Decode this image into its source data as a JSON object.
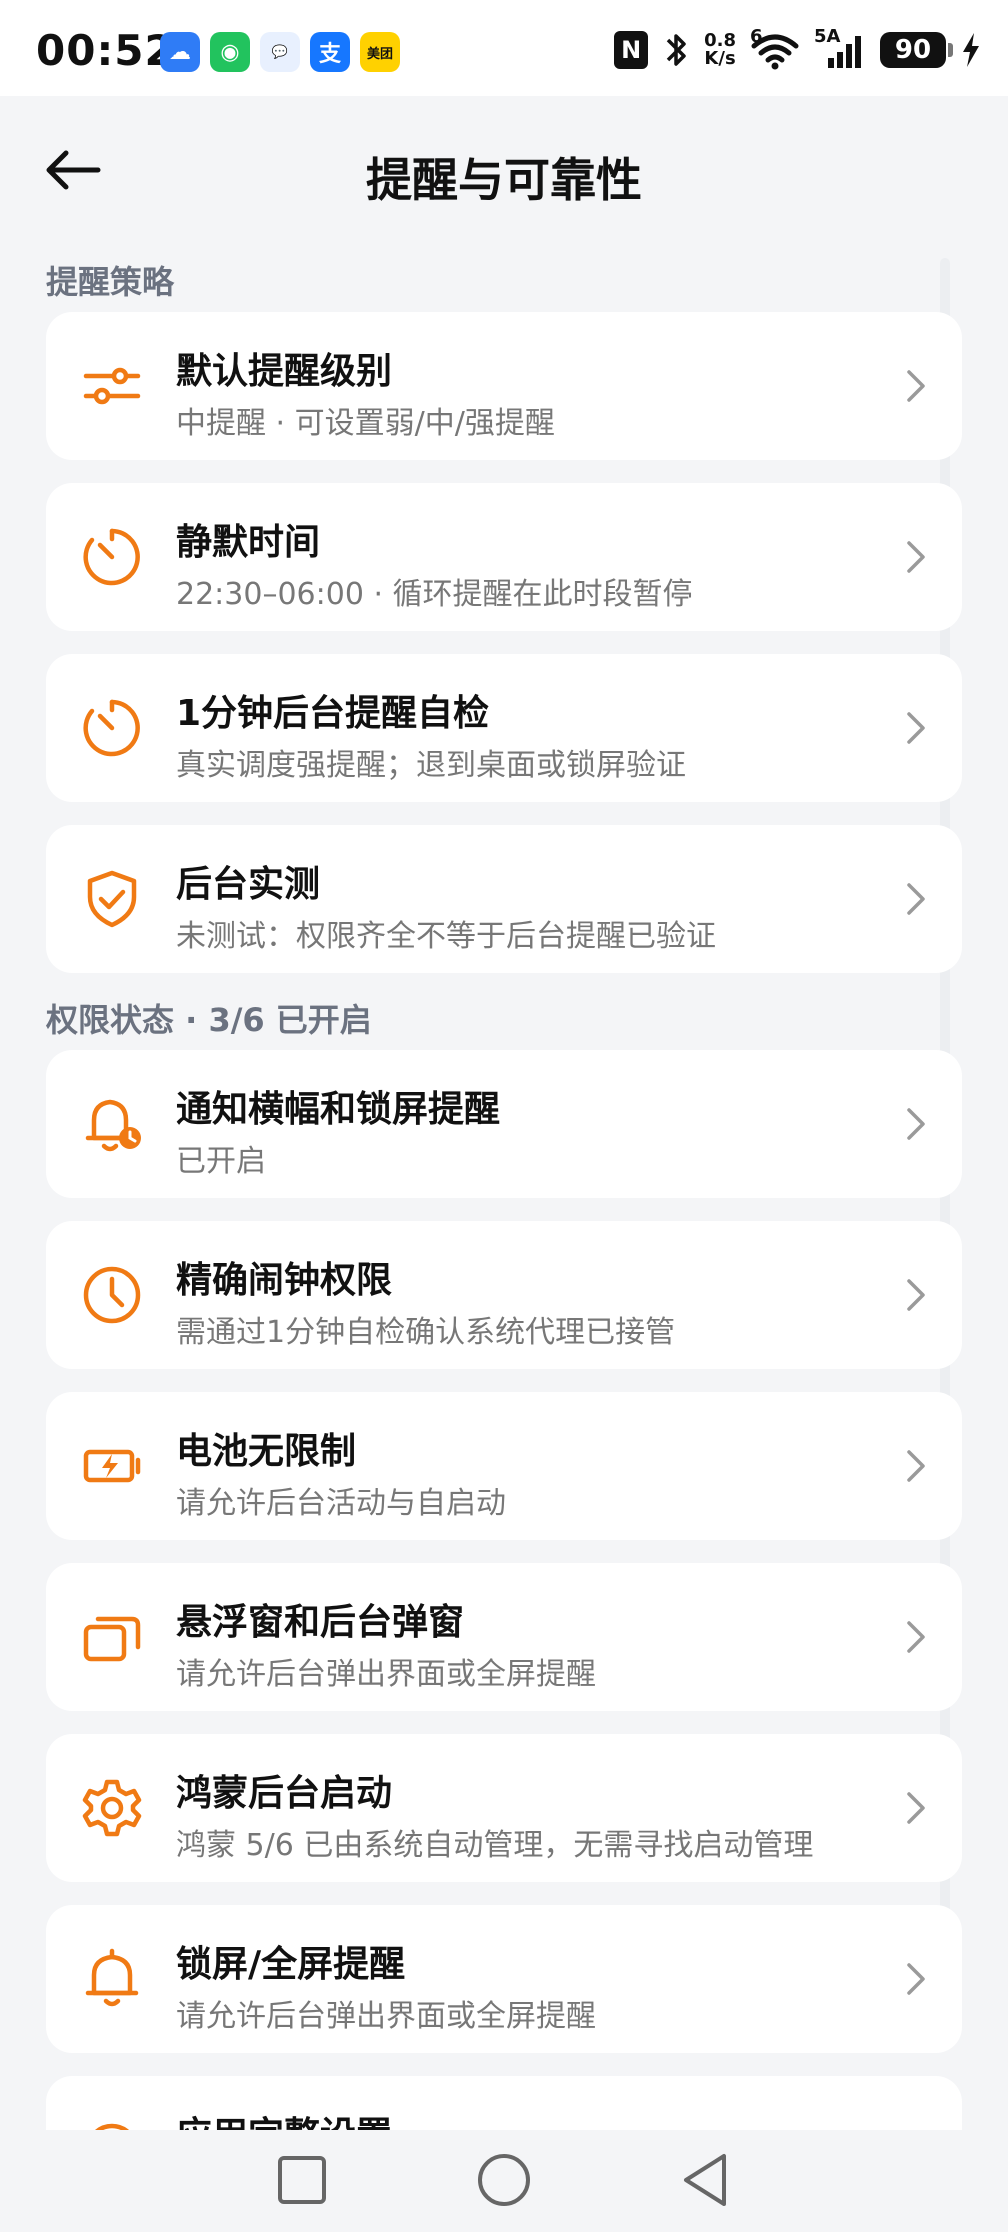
{
  "status": {
    "time": "00:52",
    "apps": [
      {
        "name": "weather-app-icon",
        "glyph": "☁",
        "color": "#2f7cf6"
      },
      {
        "name": "wechat-shield-icon",
        "glyph": "◉",
        "color": "#22c35e"
      },
      {
        "name": "chat-bubble-icon",
        "glyph": "💬",
        "color": "#e8f0fe"
      },
      {
        "name": "alipay-icon",
        "glyph": "支",
        "color": "#1677ff"
      },
      {
        "name": "meituan-icon",
        "glyph": "美团",
        "color": "#ffd100"
      }
    ],
    "nfc_label": "N",
    "speed_top": "0.8",
    "speed_bottom": "K/s",
    "wifi_label": "6",
    "signal_label": "5A",
    "battery": "90"
  },
  "header": {
    "title": "提醒与可靠性"
  },
  "sections": [
    {
      "title": "提醒策略",
      "items": [
        {
          "icon": "sliders-icon",
          "title": "默认提醒级别",
          "subtitle": "中提醒 · 可设置弱/中/强提醒"
        },
        {
          "icon": "timer-icon",
          "title": "静默时间",
          "subtitle": "22:30–06:00 · 循环提醒在此时段暂停"
        },
        {
          "icon": "timer-icon",
          "title": "1分钟后台提醒自检",
          "subtitle": "真实调度强提醒；退到桌面或锁屏验证"
        },
        {
          "icon": "shield-check-icon",
          "title": "后台实测",
          "subtitle": "未测试：权限齐全不等于后台提醒已验证"
        }
      ]
    },
    {
      "title": "权限状态 · 3/6 已开启",
      "items": [
        {
          "icon": "bell-clock-icon",
          "title": "通知横幅和锁屏提醒",
          "subtitle": "已开启"
        },
        {
          "icon": "clock-icon",
          "title": "精确闹钟权限",
          "subtitle": "需通过1分钟自检确认系统代理已接管"
        },
        {
          "icon": "battery-bolt-icon",
          "title": "电池无限制",
          "subtitle": "请允许后台活动与自启动"
        },
        {
          "icon": "windows-icon",
          "title": "悬浮窗和后台弹窗",
          "subtitle": "请允许后台弹出界面或全屏提醒"
        },
        {
          "icon": "gear-icon",
          "title": "鸿蒙后台启动",
          "subtitle": "鸿蒙 5/6 已由系统自动管理，无需寻找启动管理"
        },
        {
          "icon": "bell-icon",
          "title": "锁屏/全屏提醒",
          "subtitle": "请允许后台弹出界面或全屏提醒"
        },
        {
          "icon": "settings-icon",
          "title": "应用完整设置",
          "subtitle": ""
        }
      ]
    }
  ],
  "colors": {
    "accent": "#f07a14",
    "background": "#f4f5f7",
    "card": "#ffffff"
  }
}
